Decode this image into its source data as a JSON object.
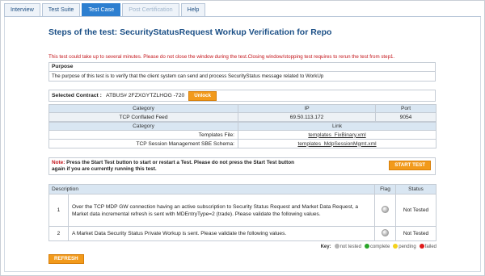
{
  "tabs": [
    {
      "label": "Interview",
      "state": "normal"
    },
    {
      "label": "Test Suite",
      "state": "normal"
    },
    {
      "label": "Test Case",
      "state": "active"
    },
    {
      "label": "Post Certification",
      "state": "disabled"
    },
    {
      "label": "Help",
      "state": "normal"
    }
  ],
  "title": "Steps of the test: SecurityStatusRequest Workup Verification for Repo",
  "warning": "This test could take up to several minutes. Please do not close the window during the test.Closing window/stopping test requires to rerun the test from step1.",
  "purpose": {
    "heading": "Purpose",
    "text": "The purpose of this test is to verify that the client system can send and process SecurityStatus message related to WorkUp"
  },
  "contract": {
    "label": "Selected Contract :",
    "value": "ATBUS# 2FZXGYTZLHOG -720",
    "unlock_label": "Unlock"
  },
  "feed_table": {
    "headers": [
      "Category",
      "IP",
      "Port"
    ],
    "row": [
      "TCP Conflated Feed",
      "69.50.113.172",
      "9054"
    ]
  },
  "link_table": {
    "headers": [
      "Category",
      "Link"
    ],
    "rows": [
      [
        "Templates File:",
        "templates_FixBinary.xml"
      ],
      [
        "TCP Session Management SBE Schema:",
        "templates_MdpSessionMgmt.xml"
      ]
    ]
  },
  "note": {
    "label": "Note:",
    "line1": " Press the Start Test button to start or restart a Test. Please do not press the Start Test button",
    "line2": "again if you are currently running this test.",
    "start_label": "START TEST"
  },
  "steps_table": {
    "headers": [
      "Description",
      "Flag",
      "Status"
    ],
    "rows": [
      {
        "num": "1",
        "desc": "Over the TCP MDP GW connection having an active subscription to Security Status Request and Market Data Request, a Market data incremental refresh is sent with MDEntryType=2 (trade). Please validate the following values.",
        "status": "Not Tested"
      },
      {
        "num": "2",
        "desc": "A Market Data Security Status Private Workup is sent. Please validate the following values.",
        "status": "Not Tested"
      }
    ]
  },
  "key": {
    "label": "Key:",
    "items": [
      {
        "label": "not tested",
        "color": "#b5b5b5"
      },
      {
        "label": "complete",
        "color": "#2aa52a"
      },
      {
        "label": "pending",
        "color": "#f4d21c"
      },
      {
        "label": "failed",
        "color": "#e01b1b"
      }
    ]
  },
  "refresh_label": "REFRESH"
}
